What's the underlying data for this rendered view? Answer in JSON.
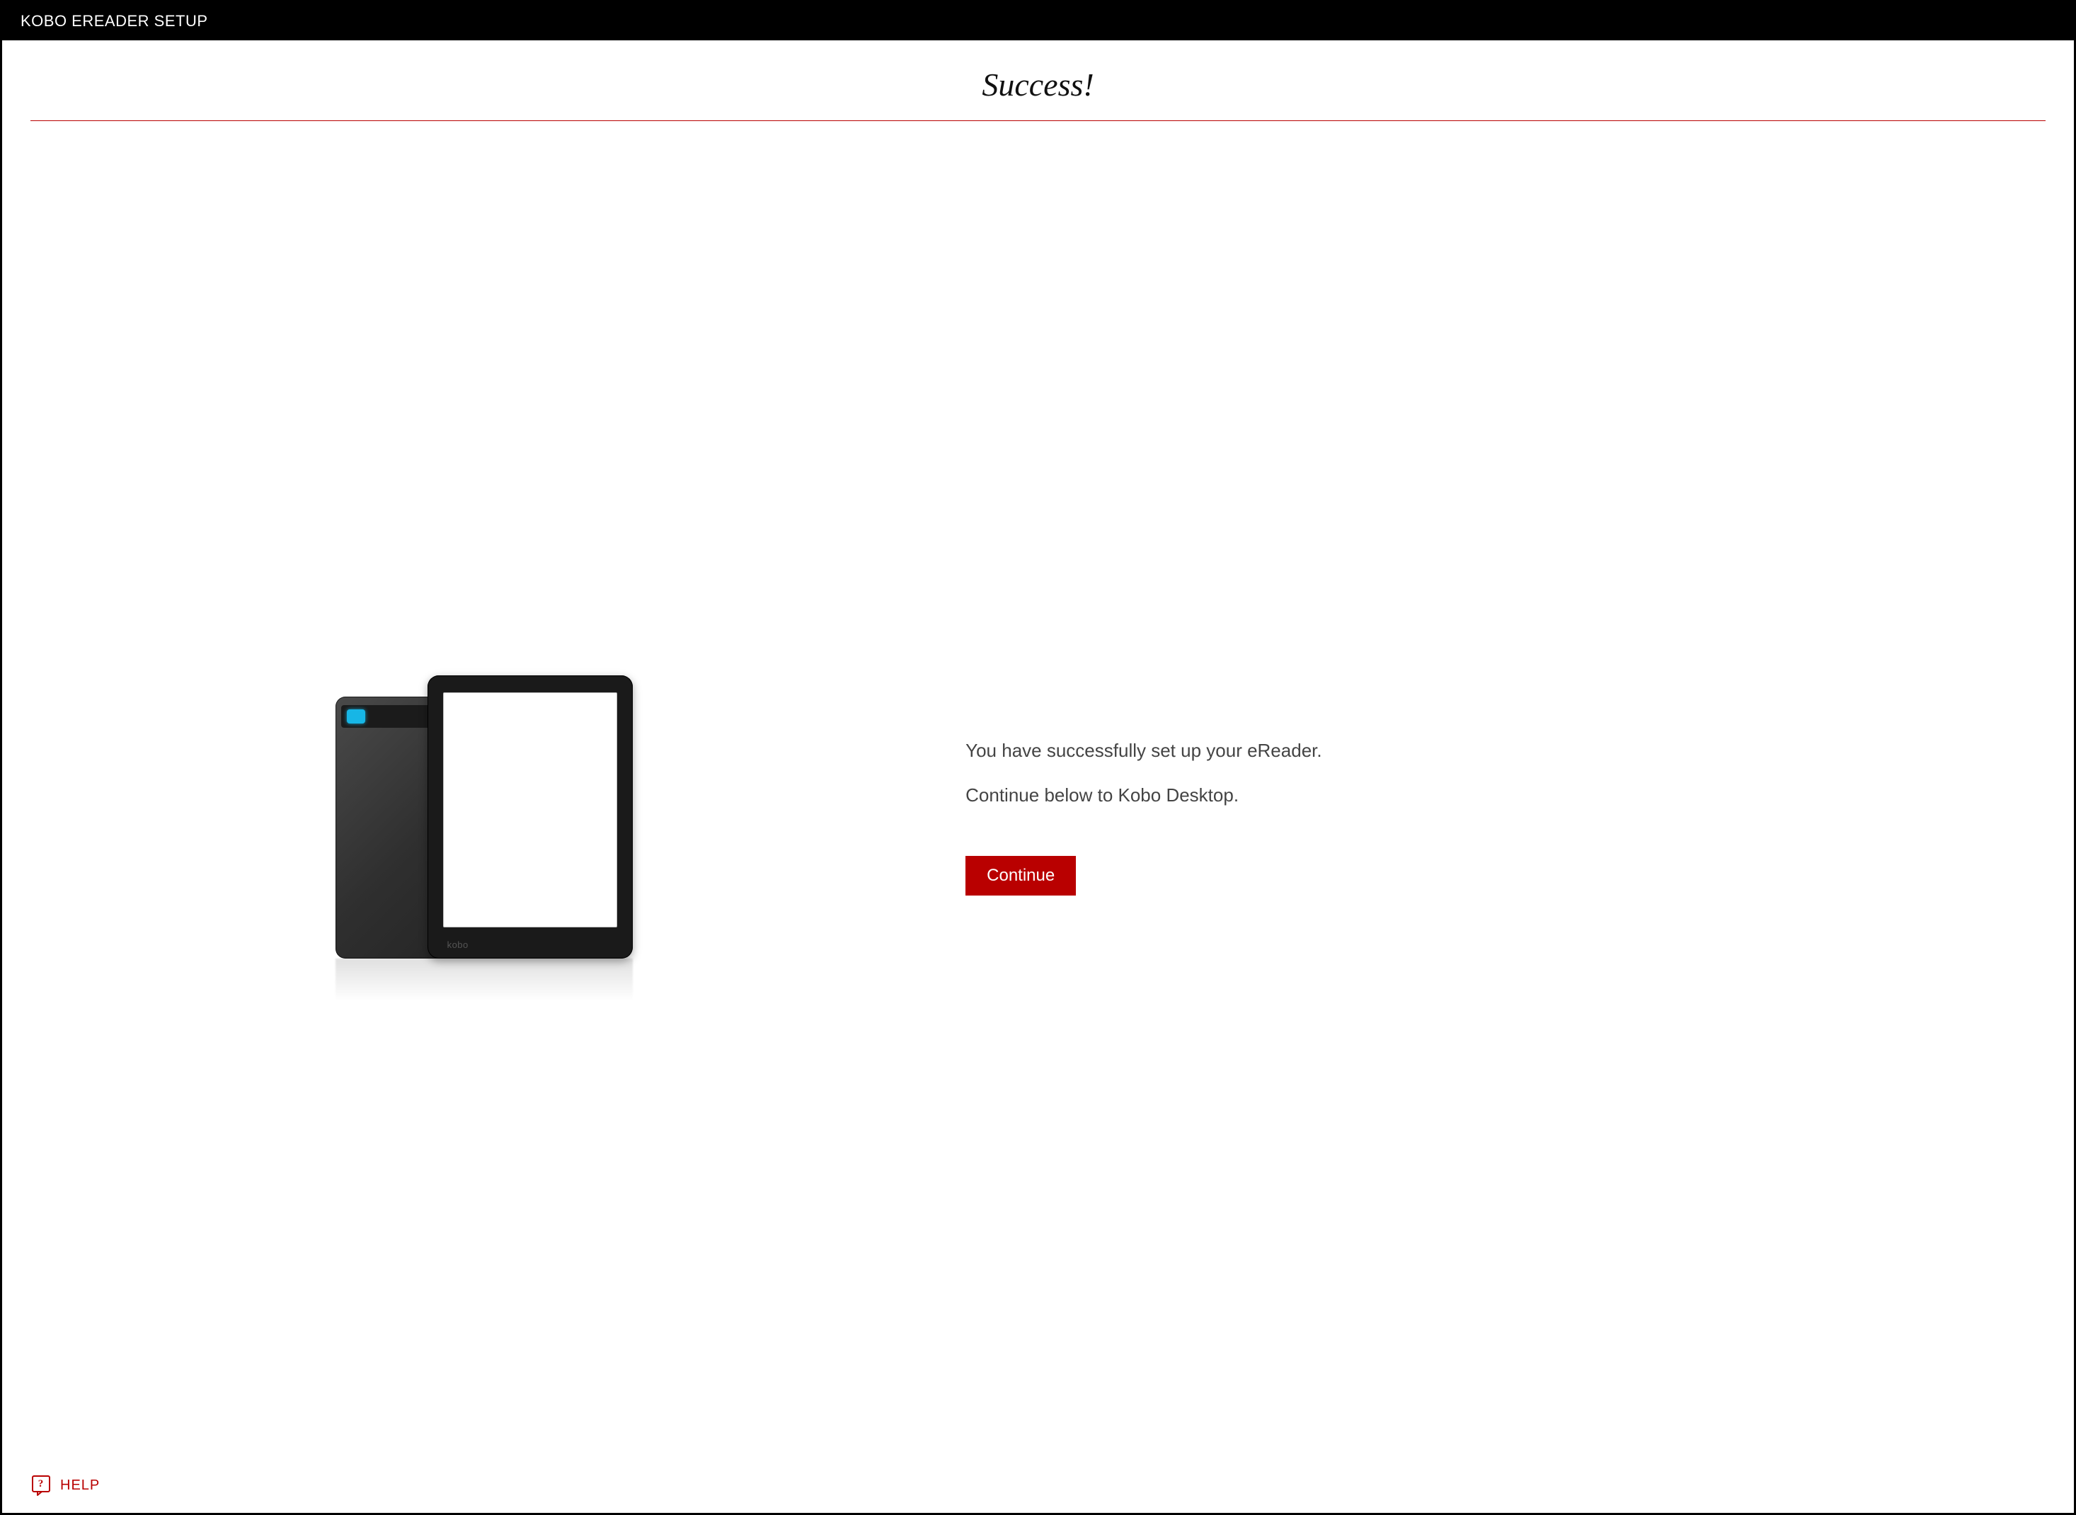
{
  "titlebar": {
    "title": "KOBO EREADER SETUP"
  },
  "main": {
    "heading": "Success!",
    "message_line1": "You have successfully set up your eReader.",
    "message_line2": "Continue below to Kobo Desktop.",
    "continue_label": "Continue",
    "device_brand": "kobo"
  },
  "footer": {
    "help_label": "HELP"
  },
  "colors": {
    "accent": "#b90000"
  }
}
